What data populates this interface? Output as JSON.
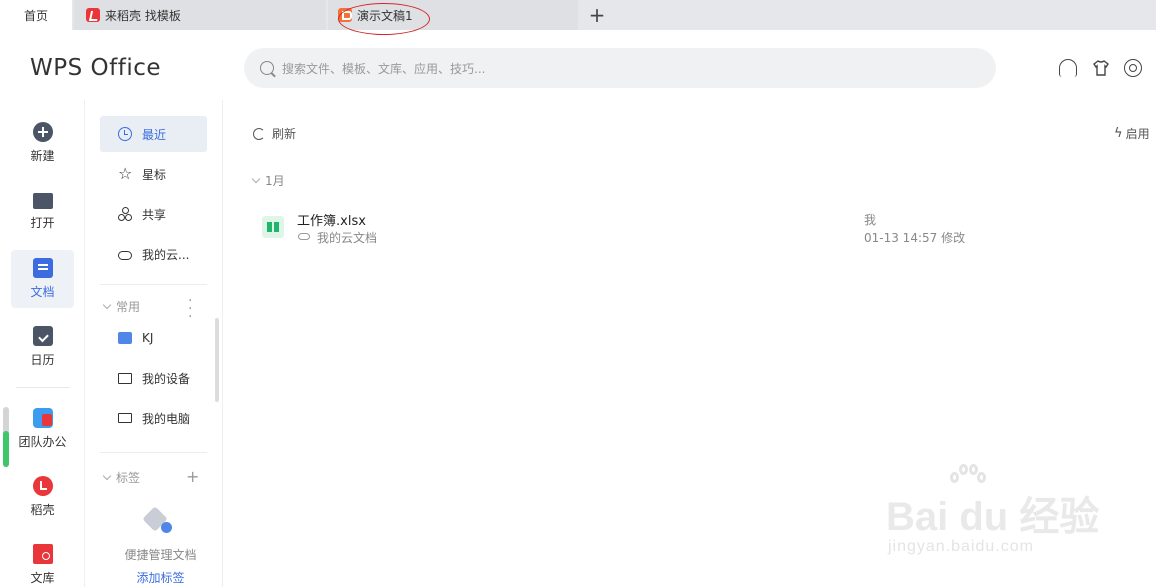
{
  "tabs": {
    "home": "首页",
    "docer": "来稻壳 找模板",
    "ppt": "演示文稿1",
    "add": "+"
  },
  "header": {
    "logo": "WPS Office",
    "search_placeholder": "搜索文件、模板、文库、应用、技巧..."
  },
  "nav": {
    "new": "新建",
    "open": "打开",
    "docs": "文档",
    "calendar": "日历",
    "team": "团队办公",
    "docer": "稻壳",
    "library": "文库"
  },
  "sub": {
    "recent": "最近",
    "starred": "星标",
    "shared": "共享",
    "cloud": "我的云...",
    "common_header": "常用",
    "kj": "KJ",
    "device": "我的设备",
    "pc": "我的电脑",
    "tags_header": "标签",
    "tag_empty": "便捷管理文档",
    "tag_add": "添加标签"
  },
  "main": {
    "refresh": "刷新",
    "launch": "启用",
    "month": "1月",
    "file": {
      "name": "工作簿.xlsx",
      "location": "我的云文档",
      "owner": "我",
      "time": "01-13 14:57 修改"
    }
  },
  "watermark": {
    "main": "Bai du 经验",
    "sub": "jingyan.baidu.com"
  },
  "colors": {
    "accent": "#3b6de0",
    "annotation": "#d12a2a"
  }
}
